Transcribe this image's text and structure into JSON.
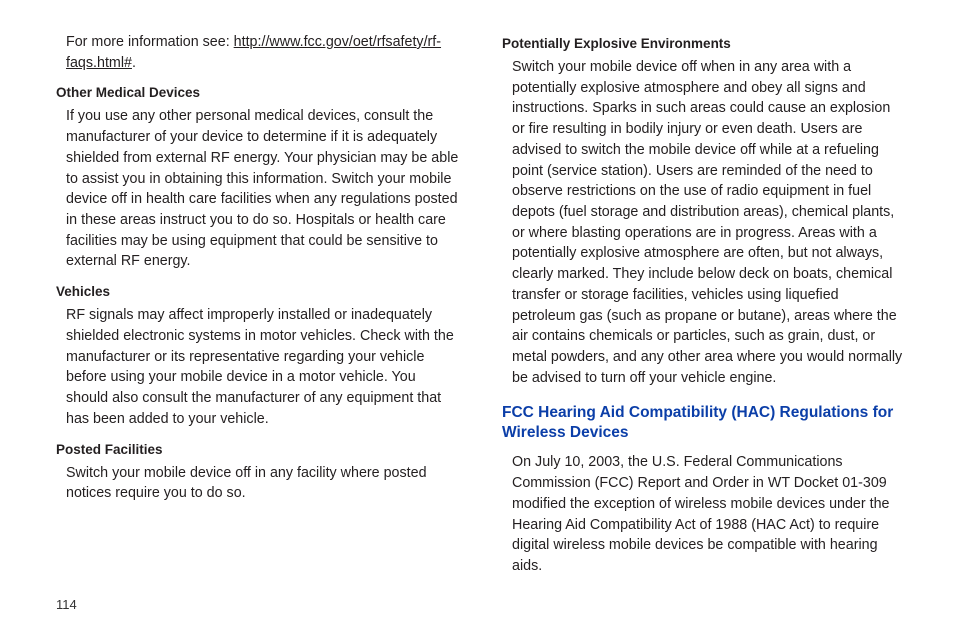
{
  "left": {
    "intro_prefix": "For more information see: ",
    "intro_link": "http://www.fcc.gov/oet/rfsafety/rf-faqs.html#",
    "intro_suffix": ".",
    "h1": "Other Medical Devices",
    "p1": "If you use any other personal medical devices, consult the manufacturer of your device to determine if it is adequately shielded from external RF energy. Your physician may be able to assist you in obtaining this information. Switch your mobile device off in health care facilities when any regulations posted in these areas instruct you to do so. Hospitals or health care facilities may be using equipment that could be sensitive to external RF energy.",
    "h2": "Vehicles",
    "p2": "RF signals may affect improperly installed or inadequately shielded electronic systems in motor vehicles. Check with the manufacturer or its representative regarding your vehicle before using your mobile device in a motor vehicle. You should also consult the manufacturer of any equipment that has been added to your vehicle.",
    "h3": "Posted Facilities",
    "p3": "Switch your mobile device off in any facility where posted notices require you to do so."
  },
  "right": {
    "h1": "Potentially Explosive Environments",
    "p1": "Switch your mobile device off when in any area with a potentially explosive atmosphere and obey all signs and instructions. Sparks in such areas could cause an explosion or fire resulting in bodily injury or even death. Users are advised to switch the mobile device off while at a refueling point (service station). Users are reminded of the need to observe restrictions on the use of radio equipment in fuel depots (fuel storage and distribution areas), chemical plants, or where blasting operations are in progress. Areas with a potentially explosive atmosphere are often, but not always, clearly marked. They include below deck on boats, chemical transfer or storage facilities, vehicles using liquefied petroleum gas (such as propane or butane), areas where the air contains chemicals or particles, such as grain, dust, or metal powders, and any other area where you would normally be advised to turn off your vehicle engine.",
    "section": "FCC Hearing Aid Compatibility (HAC) Regulations for Wireless Devices",
    "p2": "On July 10, 2003, the U.S. Federal Communications Commission (FCC) Report and Order in WT Docket 01-309 modified the exception of wireless mobile devices under the Hearing Aid Compatibility Act of 1988 (HAC Act) to require digital wireless mobile devices be compatible with hearing aids."
  },
  "page_number": "114"
}
